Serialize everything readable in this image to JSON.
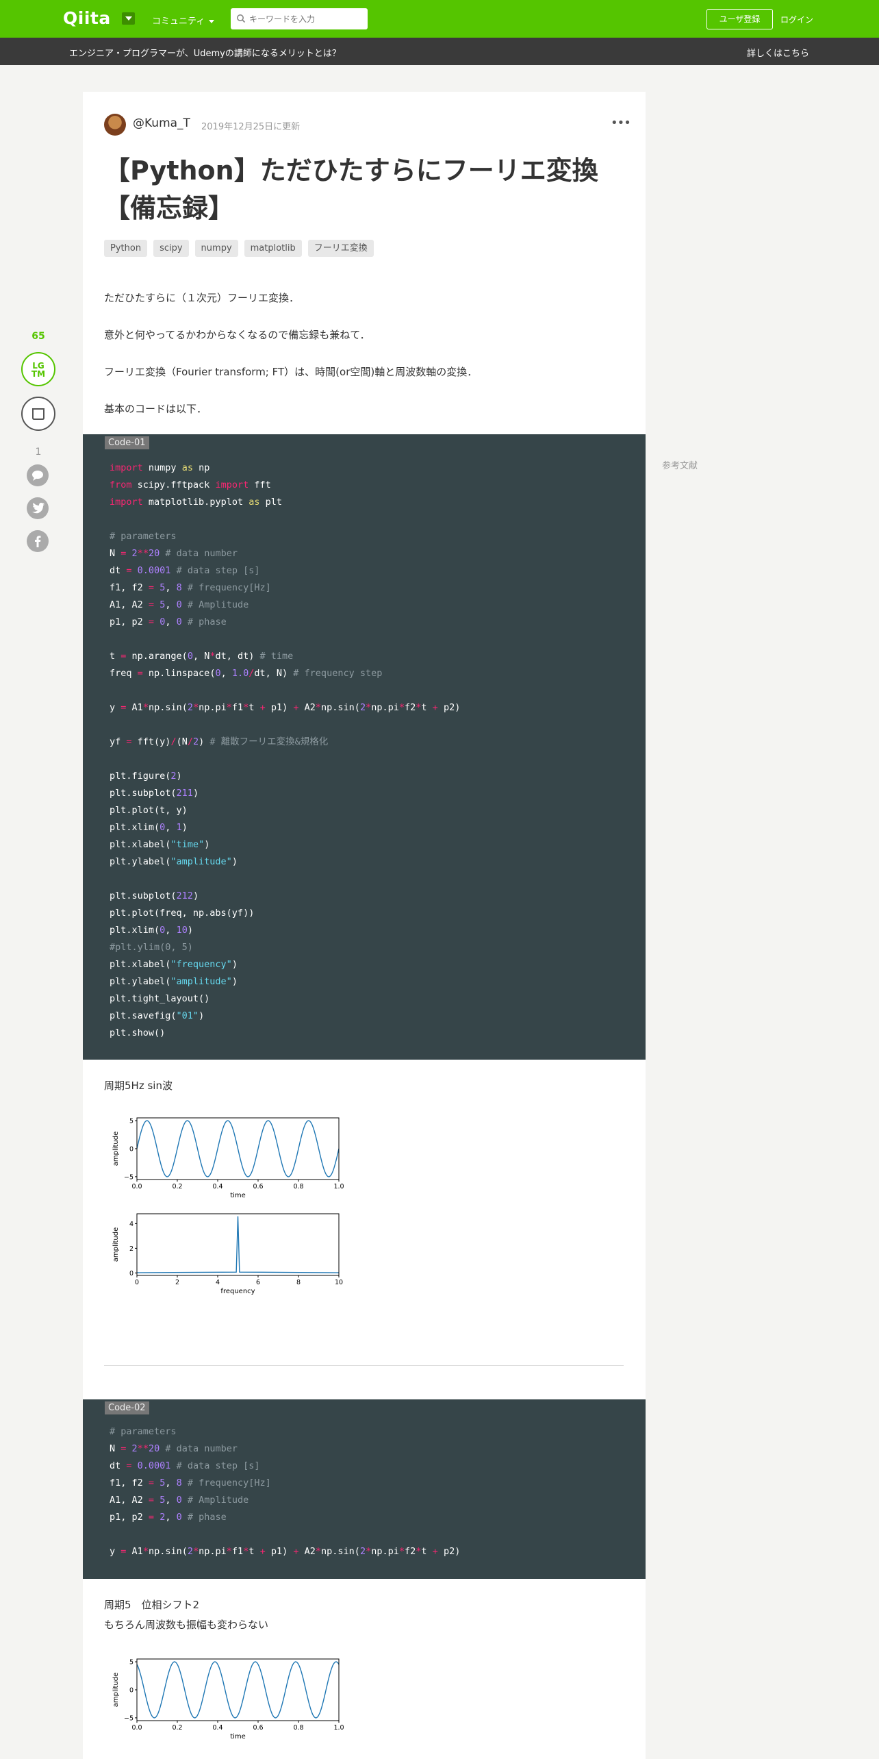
{
  "header": {
    "logo": "Qiita",
    "community": "コミュニティ",
    "search_placeholder": "キーワードを入力",
    "signup": "ユーザ登録",
    "login": "ログイン"
  },
  "promo": {
    "text": "エンジニア・プログラマーが、Udemyの講師になるメリットとは？",
    "link": "詳しくはこちら"
  },
  "sidebar": {
    "lgtm_count": "65",
    "lgtm_label_1": "LG",
    "lgtm_label_2": "TM",
    "comment_count": "1",
    "references": "参考文献"
  },
  "article": {
    "author": "@Kuma_T",
    "updated": "2019年12月25日に更新",
    "title": "【Python】ただひたすらにフーリエ変換【備忘録】",
    "tags": [
      "Python",
      "scipy",
      "numpy",
      "matplotlib",
      "フーリエ変換"
    ],
    "paragraphs": [
      "ただひたすらに（１次元）フーリエ変換．",
      "意外と何やってるかわからなくなるので備忘録も兼ねて．",
      "フーリエ変換（Fourier transform; FT）は、時間(or空間)軸と周波数軸の変換．",
      "基本のコードは以下．"
    ],
    "code1_label": "Code-01",
    "caption1": "周期5Hz sin波",
    "code2_label": "Code-02",
    "caption2_line1": "周期5　位相シフト2",
    "caption2_line2": "もちろん周波数も振幅も変わらない"
  },
  "code1": [
    [
      [
        "kw",
        "import"
      ],
      [
        "t",
        " numpy "
      ],
      [
        "as",
        "as"
      ],
      [
        "t",
        " np"
      ]
    ],
    [
      [
        "kw",
        "from"
      ],
      [
        "t",
        " scipy.fftpack "
      ],
      [
        "kw",
        "import"
      ],
      [
        "t",
        " fft"
      ]
    ],
    [
      [
        "kw",
        "import"
      ],
      [
        "t",
        " matplotlib.pyplot "
      ],
      [
        "as",
        "as"
      ],
      [
        "t",
        " plt"
      ]
    ],
    [],
    [
      [
        "cm",
        "# parameters"
      ]
    ],
    [
      [
        "t",
        "N "
      ],
      [
        "op",
        "="
      ],
      [
        "t",
        " "
      ],
      [
        "num",
        "2"
      ],
      [
        "op",
        "**"
      ],
      [
        "num",
        "20"
      ],
      [
        "t",
        " "
      ],
      [
        "cm",
        "# data number"
      ]
    ],
    [
      [
        "t",
        "dt "
      ],
      [
        "op",
        "="
      ],
      [
        "t",
        " "
      ],
      [
        "num",
        "0.0001"
      ],
      [
        "t",
        " "
      ],
      [
        "cm",
        "# data step [s]"
      ]
    ],
    [
      [
        "t",
        "f1, f2 "
      ],
      [
        "op",
        "="
      ],
      [
        "t",
        " "
      ],
      [
        "num",
        "5"
      ],
      [
        "t",
        ", "
      ],
      [
        "num",
        "8"
      ],
      [
        "t",
        " "
      ],
      [
        "cm",
        "# frequency[Hz]"
      ]
    ],
    [
      [
        "t",
        "A1, A2 "
      ],
      [
        "op",
        "="
      ],
      [
        "t",
        " "
      ],
      [
        "num",
        "5"
      ],
      [
        "t",
        ", "
      ],
      [
        "num",
        "0"
      ],
      [
        "t",
        " "
      ],
      [
        "cm",
        "# Amplitude"
      ]
    ],
    [
      [
        "t",
        "p1, p2 "
      ],
      [
        "op",
        "="
      ],
      [
        "t",
        " "
      ],
      [
        "num",
        "0"
      ],
      [
        "t",
        ", "
      ],
      [
        "num",
        "0"
      ],
      [
        "t",
        " "
      ],
      [
        "cm",
        "# phase"
      ]
    ],
    [],
    [
      [
        "t",
        "t "
      ],
      [
        "op",
        "="
      ],
      [
        "t",
        " np.arange("
      ],
      [
        "num",
        "0"
      ],
      [
        "t",
        ", N"
      ],
      [
        "op",
        "*"
      ],
      [
        "t",
        "dt, dt) "
      ],
      [
        "cm",
        "# time"
      ]
    ],
    [
      [
        "t",
        "freq "
      ],
      [
        "op",
        "="
      ],
      [
        "t",
        " np.linspace("
      ],
      [
        "num",
        "0"
      ],
      [
        "t",
        ", "
      ],
      [
        "num",
        "1.0"
      ],
      [
        "op",
        "/"
      ],
      [
        "t",
        "dt, N) "
      ],
      [
        "cm",
        "# frequency step"
      ]
    ],
    [],
    [
      [
        "t",
        "y "
      ],
      [
        "op",
        "="
      ],
      [
        "t",
        " A1"
      ],
      [
        "op",
        "*"
      ],
      [
        "t",
        "np.sin("
      ],
      [
        "num",
        "2"
      ],
      [
        "op",
        "*"
      ],
      [
        "t",
        "np.pi"
      ],
      [
        "op",
        "*"
      ],
      [
        "t",
        "f1"
      ],
      [
        "op",
        "*"
      ],
      [
        "t",
        "t "
      ],
      [
        "op",
        "+"
      ],
      [
        "t",
        " p1) "
      ],
      [
        "op",
        "+"
      ],
      [
        "t",
        " A2"
      ],
      [
        "op",
        "*"
      ],
      [
        "t",
        "np.sin("
      ],
      [
        "num",
        "2"
      ],
      [
        "op",
        "*"
      ],
      [
        "t",
        "np.pi"
      ],
      [
        "op",
        "*"
      ],
      [
        "t",
        "f2"
      ],
      [
        "op",
        "*"
      ],
      [
        "t",
        "t "
      ],
      [
        "op",
        "+"
      ],
      [
        "t",
        " p2)"
      ]
    ],
    [],
    [
      [
        "t",
        "yf "
      ],
      [
        "op",
        "="
      ],
      [
        "t",
        " fft(y)"
      ],
      [
        "op",
        "/"
      ],
      [
        "t",
        "(N"
      ],
      [
        "op",
        "/"
      ],
      [
        "num",
        "2"
      ],
      [
        "t",
        ") "
      ],
      [
        "cm",
        "# 離散フーリエ変換&規格化"
      ]
    ],
    [],
    [
      [
        "t",
        "plt.figure("
      ],
      [
        "num",
        "2"
      ],
      [
        "t",
        ")"
      ]
    ],
    [
      [
        "t",
        "plt.subplot("
      ],
      [
        "num",
        "211"
      ],
      [
        "t",
        ")"
      ]
    ],
    [
      [
        "t",
        "plt.plot(t, y)"
      ]
    ],
    [
      [
        "t",
        "plt.xlim("
      ],
      [
        "num",
        "0"
      ],
      [
        "t",
        ", "
      ],
      [
        "num",
        "1"
      ],
      [
        "t",
        ")"
      ]
    ],
    [
      [
        "t",
        "plt.xlabel("
      ],
      [
        "st",
        "\"time\""
      ],
      [
        "t",
        ")"
      ]
    ],
    [
      [
        "t",
        "plt.ylabel("
      ],
      [
        "st",
        "\"amplitude\""
      ],
      [
        "t",
        ")"
      ]
    ],
    [],
    [
      [
        "t",
        "plt.subplot("
      ],
      [
        "num",
        "212"
      ],
      [
        "t",
        ")"
      ]
    ],
    [
      [
        "t",
        "plt.plot(freq, np.abs(yf))"
      ]
    ],
    [
      [
        "t",
        "plt.xlim("
      ],
      [
        "num",
        "0"
      ],
      [
        "t",
        ", "
      ],
      [
        "num",
        "10"
      ],
      [
        "t",
        ")"
      ]
    ],
    [
      [
        "cm",
        "#plt.ylim(0, 5)"
      ]
    ],
    [
      [
        "t",
        "plt.xlabel("
      ],
      [
        "st",
        "\"frequency\""
      ],
      [
        "t",
        ")"
      ]
    ],
    [
      [
        "t",
        "plt.ylabel("
      ],
      [
        "st",
        "\"amplitude\""
      ],
      [
        "t",
        ")"
      ]
    ],
    [
      [
        "t",
        "plt.tight_layout()"
      ]
    ],
    [
      [
        "t",
        "plt.savefig("
      ],
      [
        "st",
        "\"01\""
      ],
      [
        "t",
        ")"
      ]
    ],
    [
      [
        "t",
        "plt.show()"
      ]
    ]
  ],
  "code2": [
    [
      [
        "cm",
        "# parameters"
      ]
    ],
    [
      [
        "t",
        "N "
      ],
      [
        "op",
        "="
      ],
      [
        "t",
        " "
      ],
      [
        "num",
        "2"
      ],
      [
        "op",
        "**"
      ],
      [
        "num",
        "20"
      ],
      [
        "t",
        " "
      ],
      [
        "cm",
        "# data number"
      ]
    ],
    [
      [
        "t",
        "dt "
      ],
      [
        "op",
        "="
      ],
      [
        "t",
        " "
      ],
      [
        "num",
        "0.0001"
      ],
      [
        "t",
        " "
      ],
      [
        "cm",
        "# data step [s]"
      ]
    ],
    [
      [
        "t",
        "f1, f2 "
      ],
      [
        "op",
        "="
      ],
      [
        "t",
        " "
      ],
      [
        "num",
        "5"
      ],
      [
        "t",
        ", "
      ],
      [
        "num",
        "8"
      ],
      [
        "t",
        " "
      ],
      [
        "cm",
        "# frequency[Hz]"
      ]
    ],
    [
      [
        "t",
        "A1, A2 "
      ],
      [
        "op",
        "="
      ],
      [
        "t",
        " "
      ],
      [
        "num",
        "5"
      ],
      [
        "t",
        ", "
      ],
      [
        "num",
        "0"
      ],
      [
        "t",
        " "
      ],
      [
        "cm",
        "# Amplitude"
      ]
    ],
    [
      [
        "t",
        "p1, p2 "
      ],
      [
        "op",
        "="
      ],
      [
        "t",
        " "
      ],
      [
        "num",
        "2"
      ],
      [
        "t",
        ", "
      ],
      [
        "num",
        "0"
      ],
      [
        "t",
        " "
      ],
      [
        "cm",
        "# phase"
      ]
    ],
    [],
    [
      [
        "t",
        "y "
      ],
      [
        "op",
        "="
      ],
      [
        "t",
        " A1"
      ],
      [
        "op",
        "*"
      ],
      [
        "t",
        "np.sin("
      ],
      [
        "num",
        "2"
      ],
      [
        "op",
        "*"
      ],
      [
        "t",
        "np.pi"
      ],
      [
        "op",
        "*"
      ],
      [
        "t",
        "f1"
      ],
      [
        "op",
        "*"
      ],
      [
        "t",
        "t "
      ],
      [
        "op",
        "+"
      ],
      [
        "t",
        " p1) "
      ],
      [
        "op",
        "+"
      ],
      [
        "t",
        " A2"
      ],
      [
        "op",
        "*"
      ],
      [
        "t",
        "np.sin("
      ],
      [
        "num",
        "2"
      ],
      [
        "op",
        "*"
      ],
      [
        "t",
        "np.pi"
      ],
      [
        "op",
        "*"
      ],
      [
        "t",
        "f2"
      ],
      [
        "op",
        "*"
      ],
      [
        "t",
        "t "
      ],
      [
        "op",
        "+"
      ],
      [
        "t",
        " p2)"
      ]
    ]
  ],
  "chart_data": [
    {
      "type": "line",
      "id": "fig1_time",
      "xlabel": "time",
      "ylabel": "amplitude",
      "xlim": [
        0.0,
        1.0
      ],
      "ylim": [
        -5.5,
        5.5
      ],
      "xticks": [
        "0.0",
        "0.2",
        "0.4",
        "0.6",
        "0.8",
        "1.0"
      ],
      "yticks": [
        "5",
        "0",
        "−5"
      ],
      "series": [
        {
          "function": "sin",
          "amplitude": 5,
          "frequency_hz": 5,
          "phase": 0,
          "color": "#1f77b4"
        }
      ]
    },
    {
      "type": "line",
      "id": "fig1_freq",
      "xlabel": "frequency",
      "ylabel": "amplitude",
      "xlim": [
        0,
        10
      ],
      "ylim": [
        -0.2,
        4.8
      ],
      "xticks": [
        "0",
        "2",
        "4",
        "6",
        "8",
        "10"
      ],
      "yticks": [
        "4",
        "2",
        "0"
      ],
      "series": [
        {
          "peak_x": 5,
          "peak_y": 4.6,
          "baseline": 0.02,
          "color": "#1f77b4"
        }
      ]
    },
    {
      "type": "line",
      "id": "fig2_time",
      "xlabel": "time",
      "ylabel": "amplitude",
      "xlim": [
        0.0,
        1.0
      ],
      "ylim": [
        -5.5,
        5.5
      ],
      "xticks": [
        "0.0",
        "0.2",
        "0.4",
        "0.6",
        "0.8",
        "1.0"
      ],
      "yticks": [
        "5",
        "0",
        "−5"
      ],
      "series": [
        {
          "function": "sin",
          "amplitude": 5,
          "frequency_hz": 5,
          "phase": 2,
          "color": "#1f77b4"
        }
      ]
    }
  ]
}
